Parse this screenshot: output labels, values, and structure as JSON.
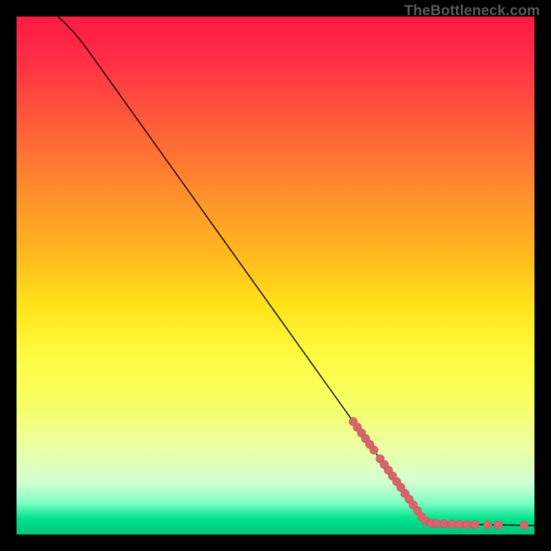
{
  "watermark": "TheBottleneck.com",
  "chart_data": {
    "type": "line",
    "title": "",
    "xlabel": "",
    "ylabel": "",
    "xlim": [
      0,
      100
    ],
    "ylim": [
      0,
      100
    ],
    "grid": false,
    "legend": false,
    "curve": [
      {
        "x": 8.0,
        "y": 100.0
      },
      {
        "x": 9.5,
        "y": 98.6
      },
      {
        "x": 11.0,
        "y": 97.0
      },
      {
        "x": 12.5,
        "y": 95.2
      },
      {
        "x": 14.0,
        "y": 93.2
      },
      {
        "x": 16.0,
        "y": 90.4
      },
      {
        "x": 18.0,
        "y": 87.6
      },
      {
        "x": 20.0,
        "y": 84.8
      },
      {
        "x": 25.0,
        "y": 77.8
      },
      {
        "x": 30.0,
        "y": 70.8
      },
      {
        "x": 35.0,
        "y": 63.8
      },
      {
        "x": 40.0,
        "y": 56.8
      },
      {
        "x": 45.0,
        "y": 49.8
      },
      {
        "x": 50.0,
        "y": 42.8
      },
      {
        "x": 55.0,
        "y": 35.8
      },
      {
        "x": 60.0,
        "y": 28.8
      },
      {
        "x": 65.0,
        "y": 21.8
      },
      {
        "x": 70.0,
        "y": 14.8
      },
      {
        "x": 75.0,
        "y": 7.8
      },
      {
        "x": 78.6,
        "y": 2.7
      },
      {
        "x": 80.0,
        "y": 2.18
      },
      {
        "x": 85.0,
        "y": 2.0
      },
      {
        "x": 90.0,
        "y": 1.9
      },
      {
        "x": 95.0,
        "y": 1.82
      },
      {
        "x": 100.0,
        "y": 1.75
      }
    ],
    "series": [
      {
        "name": "markers",
        "points": [
          {
            "x": 65.0,
            "y": 21.8
          },
          {
            "x": 65.8,
            "y": 20.7
          },
          {
            "x": 66.6,
            "y": 19.6
          },
          {
            "x": 67.4,
            "y": 18.5
          },
          {
            "x": 68.2,
            "y": 17.4
          },
          {
            "x": 69.0,
            "y": 16.3
          },
          {
            "x": 70.2,
            "y": 14.6
          },
          {
            "x": 71.0,
            "y": 13.5
          },
          {
            "x": 71.8,
            "y": 12.4
          },
          {
            "x": 72.6,
            "y": 11.3
          },
          {
            "x": 73.4,
            "y": 10.2
          },
          {
            "x": 74.2,
            "y": 9.1
          },
          {
            "x": 75.0,
            "y": 7.9
          },
          {
            "x": 75.8,
            "y": 6.8
          },
          {
            "x": 76.6,
            "y": 5.7
          },
          {
            "x": 77.4,
            "y": 4.6
          },
          {
            "x": 78.2,
            "y": 3.4
          },
          {
            "x": 79.0,
            "y": 2.6
          },
          {
            "x": 80.0,
            "y": 2.18
          },
          {
            "x": 81.0,
            "y": 2.12
          },
          {
            "x": 82.5,
            "y": 2.06
          },
          {
            "x": 84.0,
            "y": 2.0
          },
          {
            "x": 85.5,
            "y": 1.97
          },
          {
            "x": 87.0,
            "y": 1.94
          },
          {
            "x": 88.5,
            "y": 1.91
          },
          {
            "x": 91.0,
            "y": 1.87
          },
          {
            "x": 93.0,
            "y": 1.84
          },
          {
            "x": 98.0,
            "y": 1.77
          }
        ]
      }
    ],
    "marker_radius_px": 6.0,
    "colors": {
      "gradient_top": "#ff1a44",
      "gradient_bottom": "#00c47d",
      "curve": "#000000",
      "marker": "#d4656b"
    }
  }
}
